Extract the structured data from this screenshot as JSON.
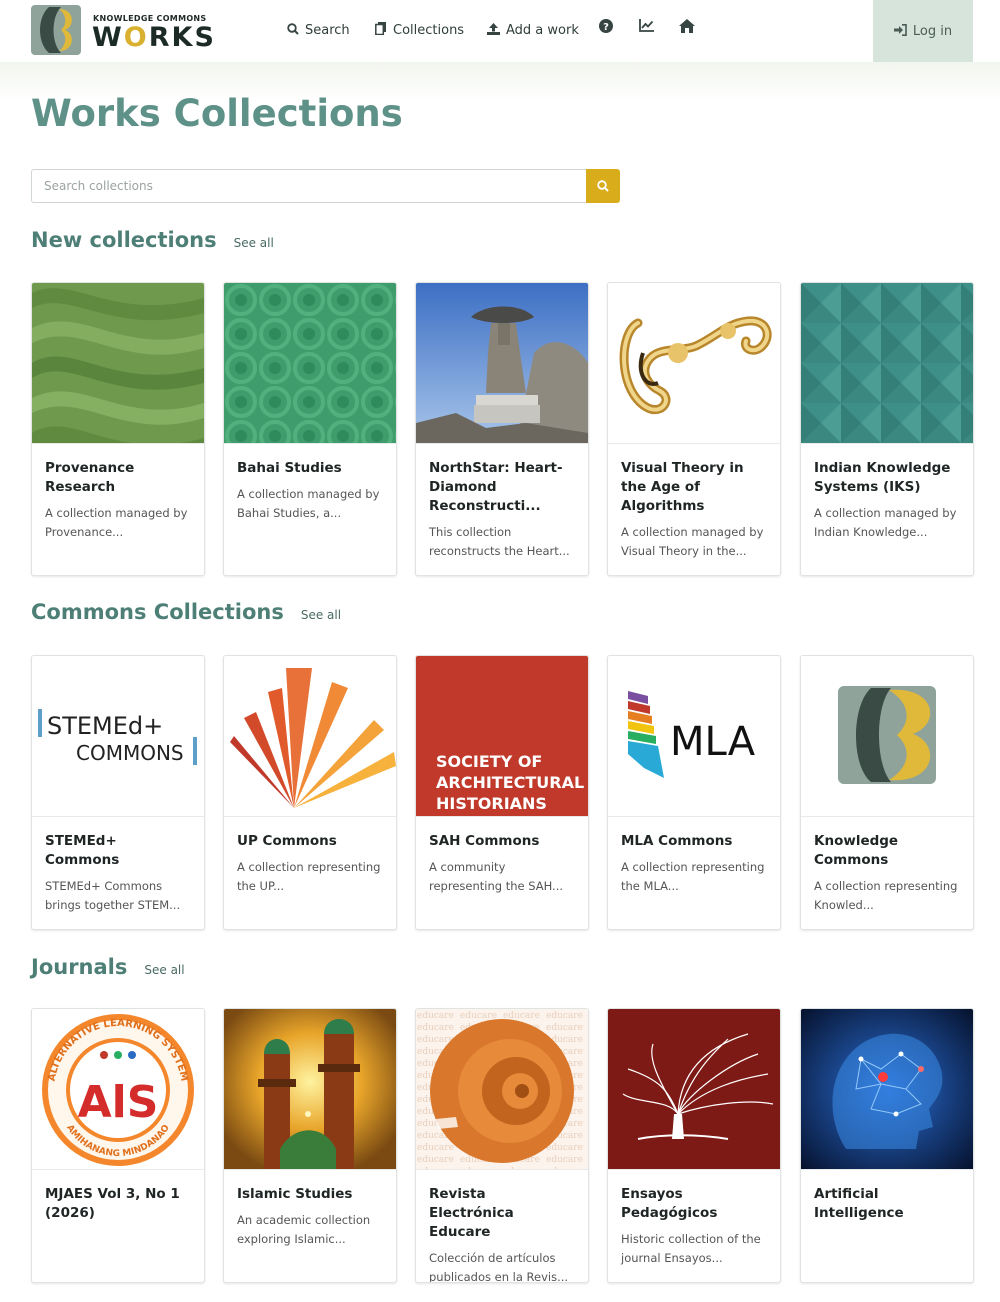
{
  "brand": {
    "small": "KNOWLEDGE COMMONS",
    "big_pre": "W",
    "big_o": "O",
    "big_post": "RKS"
  },
  "nav": {
    "search": "Search",
    "collections": "Collections",
    "add_work": "Add a work",
    "login": "Log in"
  },
  "page": {
    "title": "Works Collections"
  },
  "search": {
    "placeholder": "Search collections"
  },
  "sections": [
    {
      "title": "New collections",
      "see_all": "See all",
      "cards": [
        {
          "title": "Provenance Research",
          "desc": "A collection managed by Provenance..."
        },
        {
          "title": "Bahai Studies",
          "desc": "A collection managed by Bahai Studies, a..."
        },
        {
          "title": "NorthStar: Heart-Diamond Reconstructi...",
          "desc": "This collection reconstructs the Heart..."
        },
        {
          "title": "Visual Theory in the Age of Algorithms",
          "desc": "A collection managed by Visual Theory in the..."
        },
        {
          "title": "Indian Knowledge Systems (IKS)",
          "desc": "A collection managed by Indian Knowledge..."
        }
      ]
    },
    {
      "title": "Commons Collections",
      "see_all": "See all",
      "cards": [
        {
          "title": "STEMEd+ Commons",
          "desc": "STEMEd+ Commons brings together STEM..."
        },
        {
          "title": "UP Commons",
          "desc": "A collection representing the UP..."
        },
        {
          "title": "SAH Commons",
          "desc": "A community representing the SAH..."
        },
        {
          "title": "MLA Commons",
          "desc": "A collection representing the MLA..."
        },
        {
          "title": "Knowledge Commons",
          "desc": "A collection representing Knowled..."
        }
      ]
    },
    {
      "title": "Journals",
      "see_all": "See all",
      "cards": [
        {
          "title": "MJAES Vol 3, No 1 (2026)",
          "desc": ""
        },
        {
          "title": "Islamic Studies",
          "desc": "An academic collection exploring Islamic..."
        },
        {
          "title": "Revista Electrónica Educare",
          "desc": "Colección de artículos publicados en la Revis..."
        },
        {
          "title": "Ensayos Pedagógicos",
          "desc": "Historic collection of the journal Ensayos..."
        },
        {
          "title": "Artificial Intelligence",
          "desc": ""
        }
      ]
    }
  ],
  "image_text": {
    "stemed_1": "STEMEd+",
    "stemed_2": "COMMONS",
    "sah_1": "SOCIETY OF",
    "sah_2": "ARCHITECTURAL",
    "sah_3": "HISTORIANS",
    "mla": "MLA",
    "als": "AlS",
    "als_ring_top": "ALTERNATIVE LEARNING SYSTEM",
    "als_ring_bottom": "AMIHANANG MINDANAO",
    "educare_bg": "educare"
  },
  "colors": {
    "accent": "#5e9188",
    "search_button": "#d9ac1c",
    "login_bg": "#d7e4dc",
    "sah_red": "#c0392b",
    "ensayos_red": "#7d1a16"
  },
  "icons": {
    "search": "search-icon",
    "collections": "copy-icon",
    "add_work": "upload-icon",
    "help": "question-circle-icon",
    "stats": "chart-line-icon",
    "home": "home-icon",
    "login": "sign-in-icon"
  }
}
